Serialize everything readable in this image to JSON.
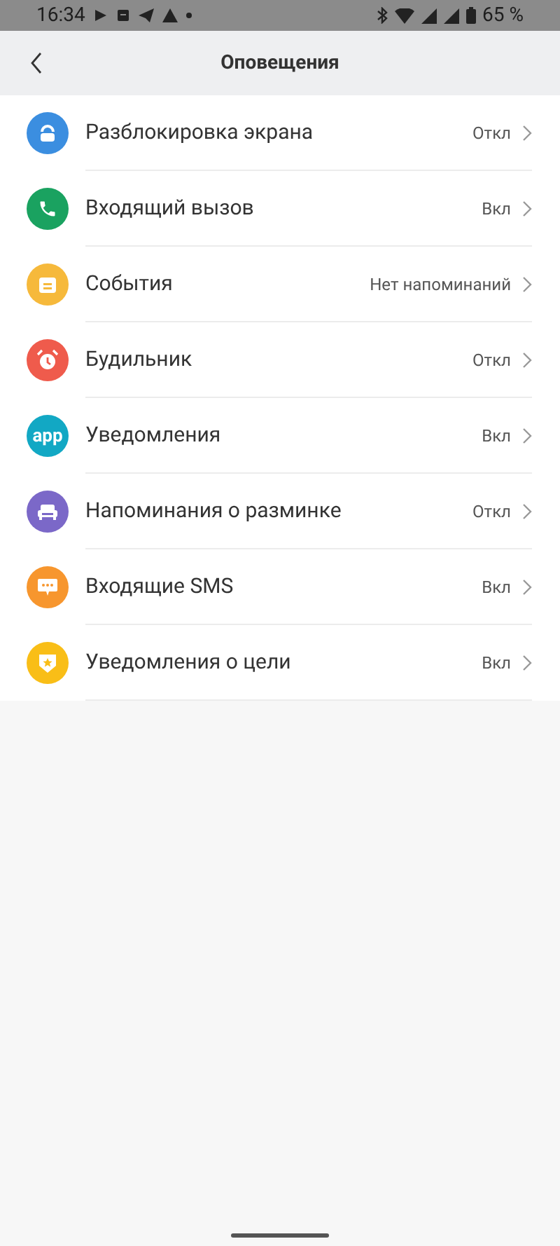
{
  "status_bar": {
    "time": "16:34",
    "battery": "65 %"
  },
  "header": {
    "title": "Оповещения"
  },
  "items": [
    {
      "kind": "unlock",
      "color": "#3b8ee0",
      "label": "Разблокировка экрана",
      "value": "Откл"
    },
    {
      "kind": "phone",
      "color": "#1aa260",
      "label": "Входящий вызов",
      "value": "Вкл"
    },
    {
      "kind": "calendar",
      "color": "#f6b93b",
      "label": "События",
      "value": "Нет напоминаний"
    },
    {
      "kind": "alarm",
      "color": "#ef5b4c",
      "label": "Будильник",
      "value": "Откл"
    },
    {
      "kind": "app",
      "color": "#12a8c4",
      "icon_text": "app",
      "label": "Уведомления",
      "value": "Вкл"
    },
    {
      "kind": "sofa",
      "color": "#7b68c8",
      "label": "Напоминания о разминке",
      "value": "Откл"
    },
    {
      "kind": "sms",
      "color": "#f7962e",
      "label": "Входящие SMS",
      "value": "Вкл"
    },
    {
      "kind": "goal",
      "color": "#f9be17",
      "label": "Уведомления о цели",
      "value": "Вкл"
    }
  ]
}
